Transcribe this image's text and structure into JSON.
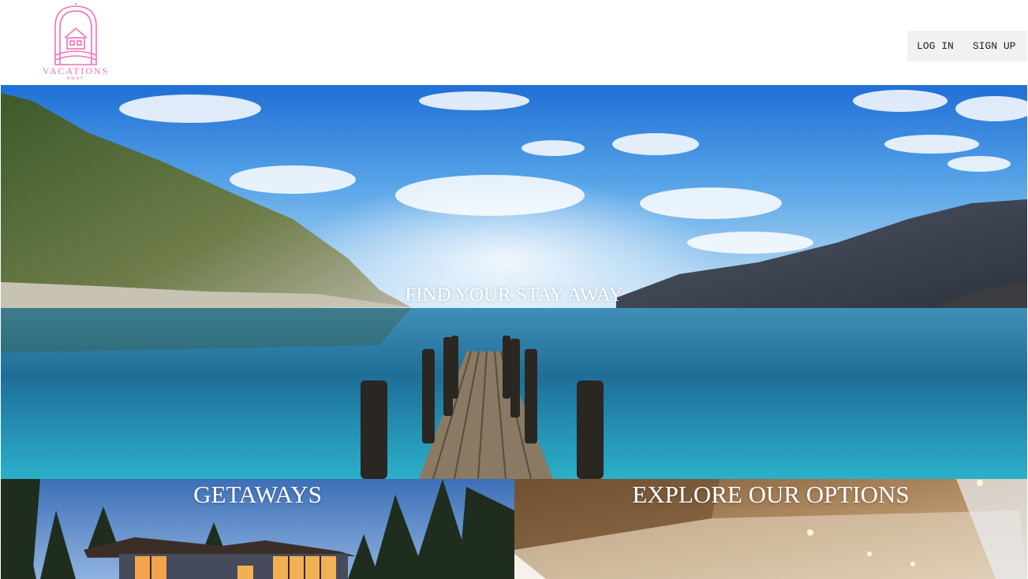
{
  "brand": {
    "name": "VACATIONS",
    "tagline": "AWAY",
    "color": "#f06fb8"
  },
  "nav": {
    "login_label": "LOG IN",
    "signup_label": "SIGN UP"
  },
  "hero": {
    "title": "FIND YOUR STAY AWAY"
  },
  "cards": [
    {
      "title": "GETAWAYS"
    },
    {
      "title": "EXPLORE OUR OPTIONS"
    }
  ]
}
